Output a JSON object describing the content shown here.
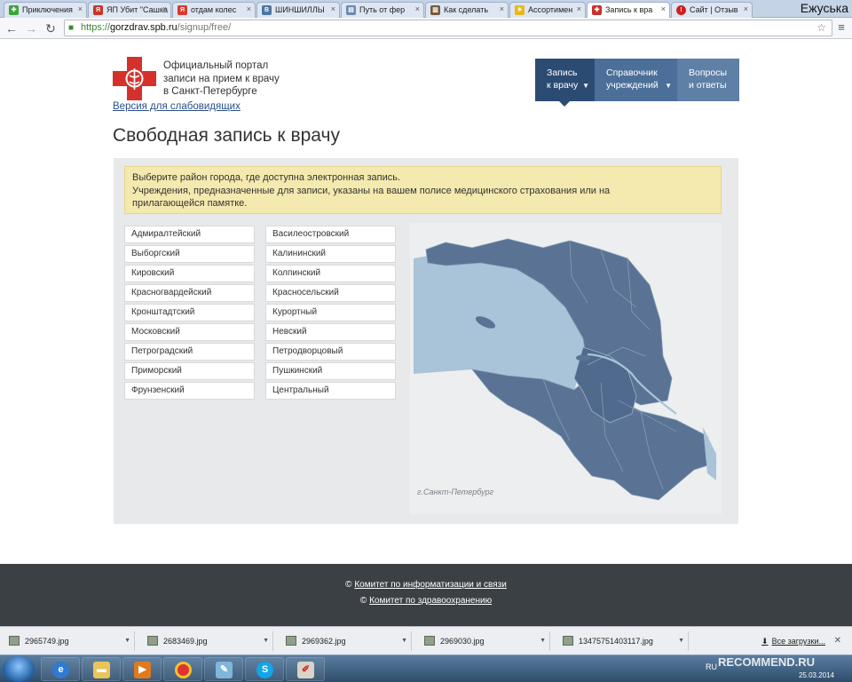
{
  "browser": {
    "tabs": [
      {
        "label": "Приключения",
        "icon": "puzzle-icon",
        "color": "#3aa53a"
      },
      {
        "label": "ЯП Убит \"Сашка",
        "icon": "yap-icon",
        "color": "#c7352a"
      },
      {
        "label": "отдам колес",
        "icon": "yandex-icon",
        "color": "#d9382b"
      },
      {
        "label": "ШИНШИЛЛЫ",
        "icon": "vk-icon",
        "color": "#4d76a1"
      },
      {
        "label": "Путь от фер",
        "icon": "doc-icon",
        "color": "#6a8ab0"
      },
      {
        "label": "Как сделать",
        "icon": "book-icon",
        "color": "#7a5a3a"
      },
      {
        "label": "Ассортимен",
        "icon": "sun-icon",
        "color": "#e7b81c"
      },
      {
        "label": "Запись к вра",
        "icon": "cross-icon",
        "color": "#c9302c"
      },
      {
        "label": "Сайт | Отзыв",
        "icon": "recommend-icon",
        "color": "#d02020"
      }
    ],
    "active_tab": 7,
    "profile_name": "Ежуська",
    "url": {
      "scheme": "https://",
      "host": "gorzdrav.spb.ru",
      "path": "/signup/free/"
    }
  },
  "header": {
    "portal_title_lines": [
      "Официальный портал",
      "записи на прием к врачу",
      "в Санкт-Петербурге"
    ],
    "low_vision_link": "Версия для слабовидящих"
  },
  "nav": [
    {
      "lines": [
        "Запись",
        "к врачу"
      ],
      "has_caret": true
    },
    {
      "lines": [
        "Справочник",
        "учреждений"
      ],
      "has_caret": true
    },
    {
      "lines": [
        "Вопросы",
        "и ответы"
      ],
      "has_caret": false
    }
  ],
  "main": {
    "title": "Свободная запись к врачу",
    "notice_lines": [
      "Выберите район города, где доступна электронная запись.",
      "Учреждения, предназначенные для записи, указаны на вашем полисе медицинского страхования или на",
      "прилагающейся памятке."
    ],
    "districts_left": [
      "Адмиралтейский",
      "Выборгский",
      "Кировский",
      "Красногвардейский",
      "Кронштадтский",
      "Московский",
      "Петроградский",
      "Приморский",
      "Фрунзенский"
    ],
    "districts_right": [
      "Василеостровский",
      "Калининский",
      "Колпинский",
      "Красносельский",
      "Курортный",
      "Невский",
      "Петродворцовый",
      "Пушкинский",
      "Центральный"
    ],
    "map_caption": "г.Санкт-Петербург"
  },
  "footer": {
    "links": [
      "Комитет по информатизации и связи",
      "Комитет по здравоохранению"
    ],
    "copyright_symbol": "©"
  },
  "downloads": {
    "files": [
      "2965749.jpg",
      "2683469.jpg",
      "2969362.jpg",
      "2969030.jpg",
      "13475751403117.jpg"
    ],
    "all_label": "Все загрузки..."
  },
  "taskbar": {
    "lang": "RU",
    "watermark": "RECOMMEND.RU",
    "date": "25.03.2014"
  },
  "colors": {
    "nav_active": "#2c4b73",
    "map_land": "#5a7394",
    "map_water": "#a9c4d9",
    "notice_bg": "#f4e9ae",
    "footer_bg": "#3b4044"
  }
}
